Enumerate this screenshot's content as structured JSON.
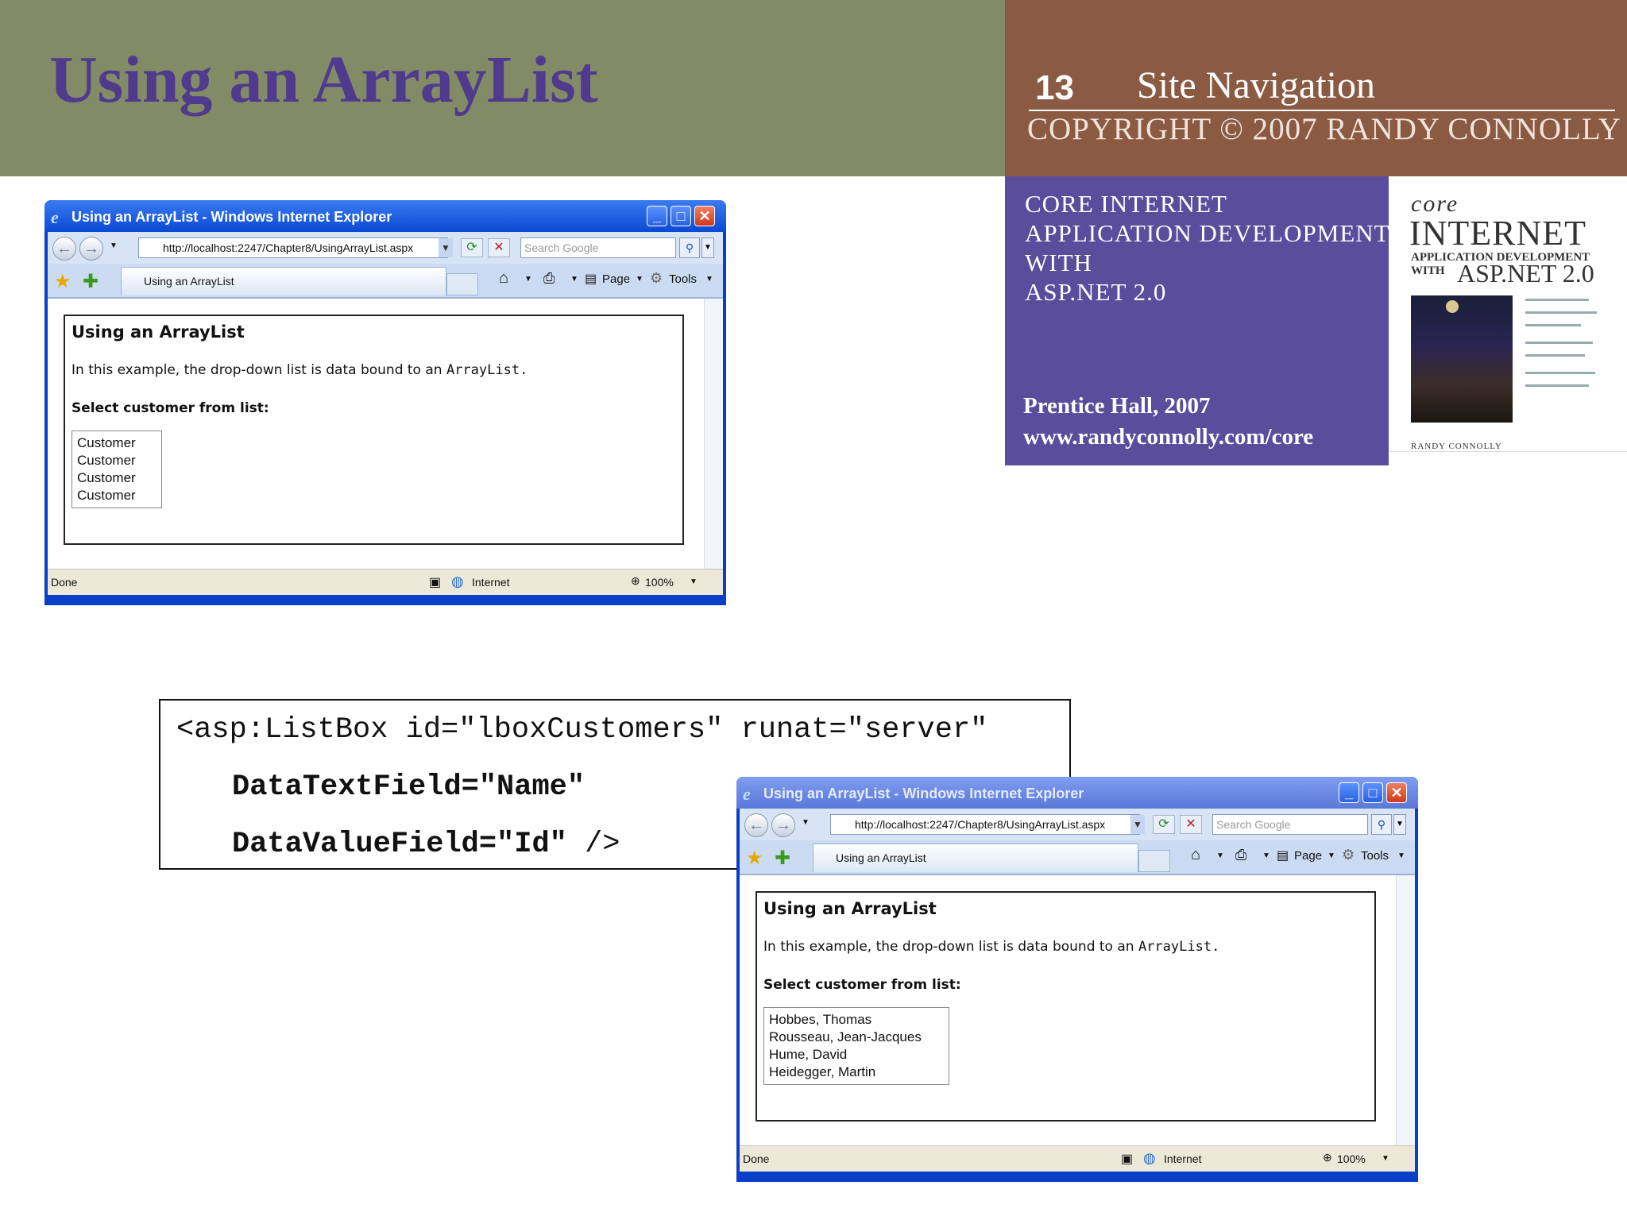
{
  "slide": {
    "title": "Using an ArrayList",
    "number": "13",
    "section": "Site Navigation",
    "copyright": "COPYRIGHT © 2007 RANDY CONNOLLY"
  },
  "book": {
    "series_lines": [
      "CORE INTERNET",
      "APPLICATION DEVELOPMENT",
      "WITH",
      "ASP.NET 2.0"
    ],
    "publisher": "Prentice Hall, 2007",
    "url": "www.randyconnolly.com/core",
    "cover": {
      "core": "core",
      "internet": "INTERNET",
      "subtitle": "APPLICATION DEVELOPMENT",
      "with": "WITH",
      "aspnet": "ASP.NET 2.0",
      "author": "RANDY CONNOLLY"
    }
  },
  "browser1": {
    "window_title": "Using an ArrayList - Windows Internet Explorer",
    "url": "http://localhost:2247/Chapter8/UsingArrayList.aspx",
    "search_placeholder": "Search Google",
    "tab_label": "Using an ArrayList",
    "cmd_page": "Page",
    "cmd_tools": "Tools",
    "status_text": "Done",
    "zone": "Internet",
    "zoom": "100%",
    "page_heading": "Using an ArrayList",
    "page_text": "In this example, the drop-down list is data bound to an",
    "page_text_code": "ArrayList.",
    "select_label": "Select customer from list:",
    "list_items": [
      "Customer",
      "Customer",
      "Customer",
      "Customer"
    ]
  },
  "browser2": {
    "window_title": "Using an ArrayList - Windows Internet Explorer",
    "url": "http://localhost:2247/Chapter8/UsingArrayList.aspx",
    "search_placeholder": "Search Google",
    "tab_label": "Using an ArrayList",
    "cmd_page": "Page",
    "cmd_tools": "Tools",
    "status_text": "Done",
    "zone": "Internet",
    "zoom": "100%",
    "page_heading": "Using an ArrayList",
    "page_text": "In this example, the drop-down list is data bound to an",
    "page_text_code": "ArrayList.",
    "select_label": "Select customer from list:",
    "list_items": [
      "Hobbes, Thomas",
      "Rousseau, Jean-Jacques",
      "Hume, David",
      "Heidegger, Martin"
    ]
  },
  "code": {
    "line1": "<asp:ListBox id=\"lboxCustomers\" runat=\"server\"",
    "line2": "DataTextField=\"Name\"",
    "line3_bold": "DataValueField=\"Id\"",
    "line3_rest": " />"
  },
  "colors": {
    "header_left": "#838b66",
    "header_right": "#8b5a43",
    "title": "#4e3b8d",
    "book_panel": "#5a4d9c",
    "ie_frame": "#0a3fc7"
  }
}
